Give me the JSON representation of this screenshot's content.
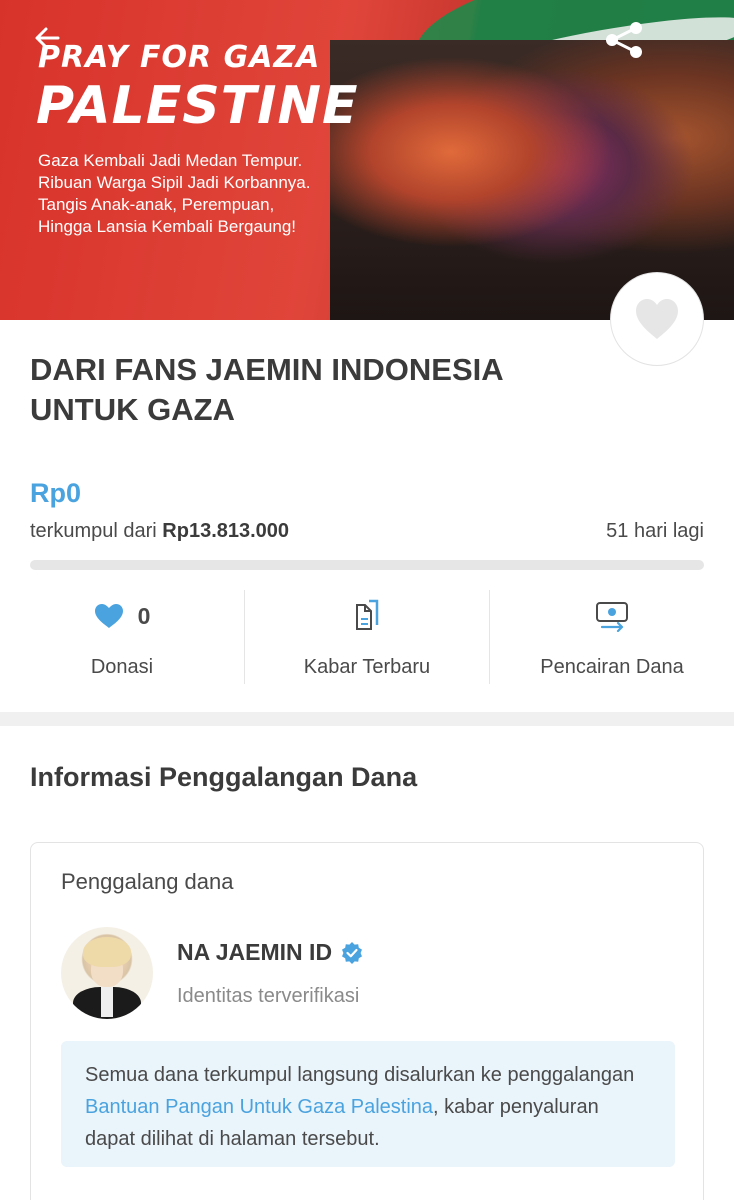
{
  "banner": {
    "title_line1": "PRAY FOR GAZA",
    "title_line2": "PALESTINE",
    "lines": [
      "Gaza Kembali Jadi Medan Tempur.",
      "Ribuan Warga Sipil Jadi Korbannya.",
      "Tangis Anak-anak, Perempuan,",
      "Hingga Lansia Kembali Bergaung!"
    ]
  },
  "campaign": {
    "title": "DARI FANS JAEMIN INDONESIA UNTUK GAZA",
    "amount": "Rp0",
    "collected_prefix": "terkumpul dari",
    "target": "Rp13.813.000",
    "days_left": "51 hari lagi",
    "progress_fraction": 0
  },
  "stats": {
    "donations": {
      "count": "0",
      "label": "Donasi",
      "icon": "heart-icon"
    },
    "updates": {
      "label": "Kabar Terbaru",
      "icon": "document-icon"
    },
    "disbursement": {
      "label": "Pencairan Dana",
      "icon": "money-transfer-icon"
    }
  },
  "fundraiser_info": {
    "section_title": "Informasi Penggalangan Dana",
    "card_label": "Penggalang dana",
    "organizer_name": "NA JAEMIN ID",
    "verified_text": "Identitas terverifikasi",
    "notice_before": "Semua dana terkumpul langsung disalurkan ke penggalangan ",
    "notice_link": "Bantuan Pangan Untuk Gaza Palestina",
    "notice_after": ", kabar penyaluran dapat dilihat di halaman tersebut."
  },
  "colors": {
    "accent": "#4aa3df",
    "banner_red": "#e0453a",
    "text": "#4a4a4a",
    "notice_bg": "#eaf4fb"
  }
}
